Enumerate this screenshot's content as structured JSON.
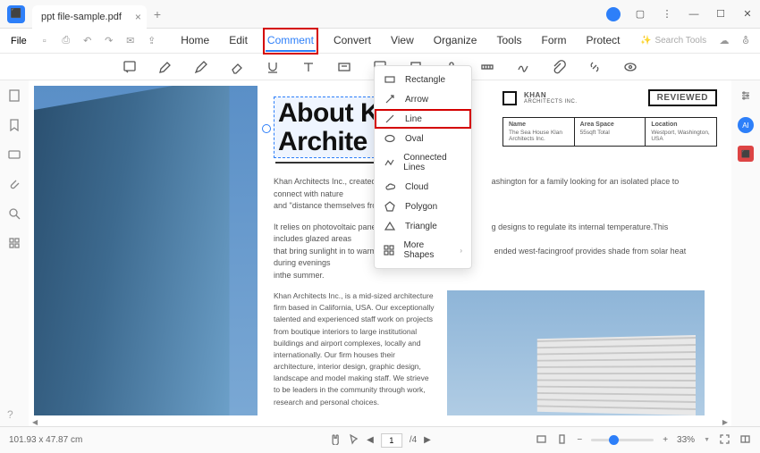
{
  "tab": {
    "title": "ppt file-sample.pdf"
  },
  "menubar": {
    "file": "File"
  },
  "menu": {
    "items": [
      "Home",
      "Edit",
      "Comment",
      "Convert",
      "View",
      "Organize",
      "Tools",
      "Form",
      "Protect"
    ],
    "active_index": 2
  },
  "search": {
    "placeholder": "Search Tools"
  },
  "dropdown": {
    "items": [
      {
        "label": "Rectangle"
      },
      {
        "label": "Arrow"
      },
      {
        "label": "Line",
        "highlighted": true
      },
      {
        "label": "Oval"
      },
      {
        "label": "Connected Lines"
      },
      {
        "label": "Cloud"
      },
      {
        "label": "Polygon"
      },
      {
        "label": "Triangle"
      },
      {
        "label": "More Shapes",
        "submenu": true
      }
    ]
  },
  "document": {
    "title_line1": "About K",
    "title_line2": "Archite",
    "logo_text": "KHAN",
    "logo_sub": "ARCHITECTS INC.",
    "stamp": "REVIEWED",
    "info": [
      {
        "label": "Name",
        "value": "The Sea House Klan Architects Inc."
      },
      {
        "label": "Area Space",
        "value": "55sqft Total"
      },
      {
        "label": "Location",
        "value": "Westport, Washington, USA"
      }
    ],
    "para1_a": "Khan Architects Inc., created thi",
    "para1_b": "ashington for a family looking for an isolated place to connect with nature",
    "para1_c": "and \"distance themselves from s",
    "para2_a": "It relies on photovoltaic panels fo",
    "para2_b": "g designs to regulate its internal temperature.This includes glazed areas",
    "para2_c": "that bring sunlight in to warm th",
    "para2_d": "ended west-facingroof provides shade from solar heat during evenings",
    "para2_e": "inthe summer.",
    "col_text": "Khan Architects Inc., is a mid-sized architecture firm based in California, USA. Our exceptionally talented and experienced staff work on projects from boutique interiors to large institutional buildings and airport complexes, locally and internationally. Our firm houses their architecture, interior design, graphic design, landscape and model making staff. We strieve to be leaders in the community through work, research and personal choices."
  },
  "status": {
    "dimensions": "101.93 x 47.87 cm",
    "page_current": "1",
    "page_total": "/4",
    "zoom": "33%"
  }
}
